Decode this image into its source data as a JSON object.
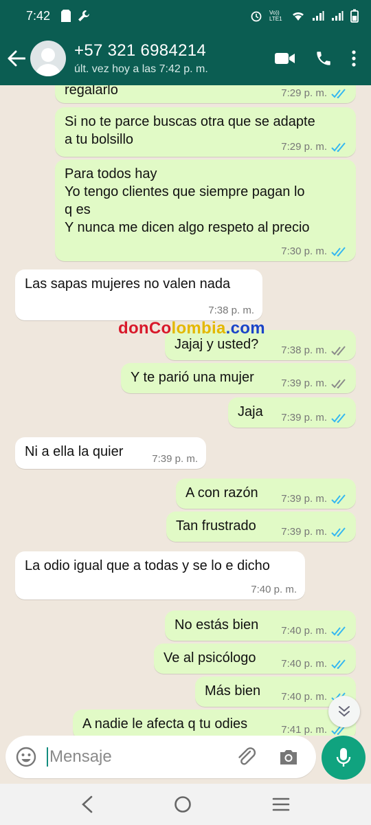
{
  "status_bar": {
    "time": "7:42",
    "network_label": "Vo)) LTE1"
  },
  "header": {
    "contact_name": "+57 321 6984214",
    "last_seen": "últ. vez hoy a las 7:42 p. m."
  },
  "colors": {
    "header_bg": "#0b5d52",
    "outgoing_bubble": "#e1fac6",
    "incoming_bubble": "#ffffff",
    "chat_bg": "#efe7dd",
    "tick_read": "#34b7f1",
    "tick_delivered": "#8a8a8a",
    "accent": "#10a37f"
  },
  "messages": [
    {
      "direction": "out",
      "text": "regalarlo",
      "time": "7:29 p. m.",
      "status": "read"
    },
    {
      "direction": "out",
      "text": "Si no te parce buscas otra que se adapte\na tu bolsillo",
      "time": "7:29 p. m.",
      "status": "read"
    },
    {
      "direction": "out",
      "text": "Para todos hay\nYo tengo clientes que siempre pagan lo\nq es\nY nunca me dicen algo respeto al precio",
      "time": "7:30 p. m.",
      "status": "read"
    },
    {
      "direction": "in",
      "text": "Las sapas mujeres no valen nada",
      "time": "7:38 p. m."
    },
    {
      "direction": "out",
      "text": "Jajaj y usted?",
      "time": "7:38 p. m.",
      "status": "delivered"
    },
    {
      "direction": "out",
      "text": "Y te parió una mujer",
      "time": "7:39 p. m.",
      "status": "delivered"
    },
    {
      "direction": "out",
      "text": "Jaja",
      "time": "7:39 p. m.",
      "status": "read"
    },
    {
      "direction": "in",
      "text": "Ni a ella la quier",
      "time": "7:39 p. m."
    },
    {
      "direction": "out",
      "text": "A con razón",
      "time": "7:39 p. m.",
      "status": "read"
    },
    {
      "direction": "out",
      "text": "Tan frustrado",
      "time": "7:39 p. m.",
      "status": "read"
    },
    {
      "direction": "in",
      "text": "La odio igual que a todas y se lo e dicho",
      "time": "7:40 p. m."
    },
    {
      "direction": "out",
      "text": "No estás bien",
      "time": "7:40 p. m.",
      "status": "read"
    },
    {
      "direction": "out",
      "text": "Ve al psicólogo",
      "time": "7:40 p. m.",
      "status": "read"
    },
    {
      "direction": "out",
      "text": "Más bien",
      "time": "7:40 p. m.",
      "status": "read"
    },
    {
      "direction": "out",
      "text": "A nadie le afecta q tu odies",
      "time": "7:41 p. m.",
      "status": "read"
    }
  ],
  "watermark": {
    "part1": "donCo",
    "part2": "lombia",
    "part3": ".com"
  },
  "composer": {
    "placeholder": "Mensaje"
  }
}
